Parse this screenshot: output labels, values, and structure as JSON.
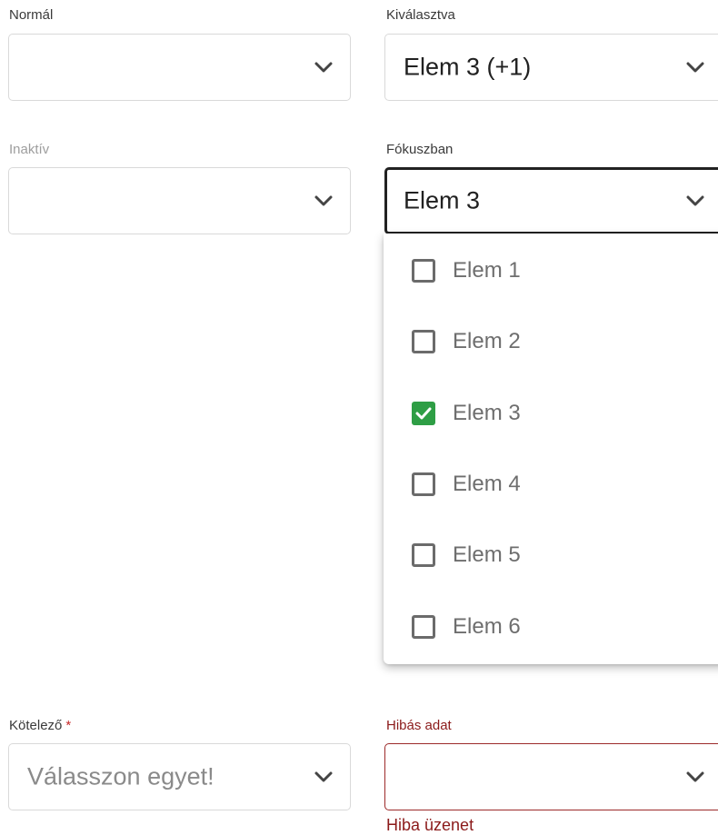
{
  "fields": {
    "normal": {
      "label": "Normál",
      "value": ""
    },
    "selected": {
      "label": "Kiválasztva",
      "value": "Elem 3 (+1)"
    },
    "inactive": {
      "label": "Inaktív",
      "value": ""
    },
    "focused": {
      "label": "Fókuszban",
      "value": "Elem 3"
    },
    "required": {
      "label": "Kötelező",
      "required_marker": "*",
      "placeholder": "Válasszon egyet!"
    },
    "invalid": {
      "label": "Hibás adat",
      "value": "",
      "error_message": "Hiba üzenet"
    }
  },
  "dropdown": {
    "options": [
      {
        "label": "Elem 1",
        "checked": false
      },
      {
        "label": "Elem 2",
        "checked": false
      },
      {
        "label": "Elem 3",
        "checked": true
      },
      {
        "label": "Elem 4",
        "checked": false
      },
      {
        "label": "Elem 5",
        "checked": false
      },
      {
        "label": "Elem 6",
        "checked": false
      }
    ]
  },
  "colors": {
    "check_accent": "#2e9e45",
    "error": "#8b1a1a",
    "focus_border": "#222222"
  },
  "icons": {
    "dropdown_arrow": "chevron-down-icon",
    "checkbox_mark": "check-icon"
  }
}
